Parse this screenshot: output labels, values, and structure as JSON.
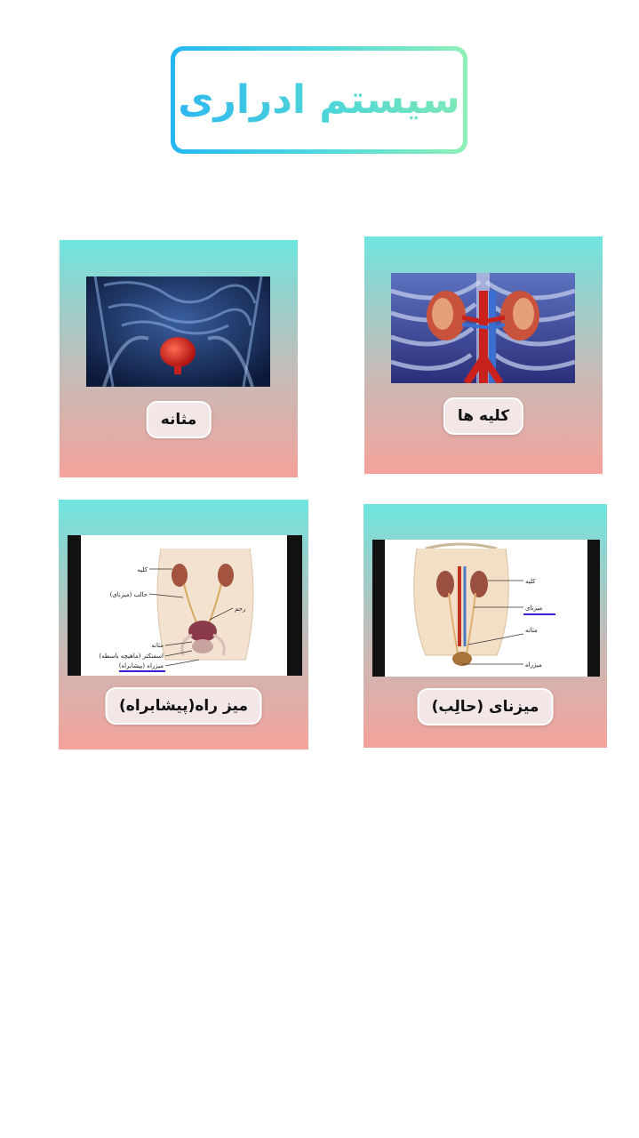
{
  "title": "سیستم ادراری",
  "cards": [
    {
      "label": "کلیه ها"
    },
    {
      "label": "مثانه"
    },
    {
      "label": "میزنای (حالِب)"
    },
    {
      "label": "میز راه(پیشابراه)"
    }
  ],
  "diagram_left": {
    "kidney": "کلیه",
    "ureter": "حالب (میزنای)",
    "uterus": "رحم",
    "bladder": "مثانه",
    "sphincter": "اسفنکتر (ماهیچه باسطه)",
    "urethra": "میزراه (پیشابراه)"
  },
  "diagram_right": {
    "kidney": "کلیه",
    "ureter": "میزنای",
    "bladder": "مثانه",
    "urethra": "میزراه"
  },
  "colors": {
    "accent_blue": "#25b6f2",
    "accent_green": "#8ff0b6",
    "underline": "#3a1fd1"
  }
}
